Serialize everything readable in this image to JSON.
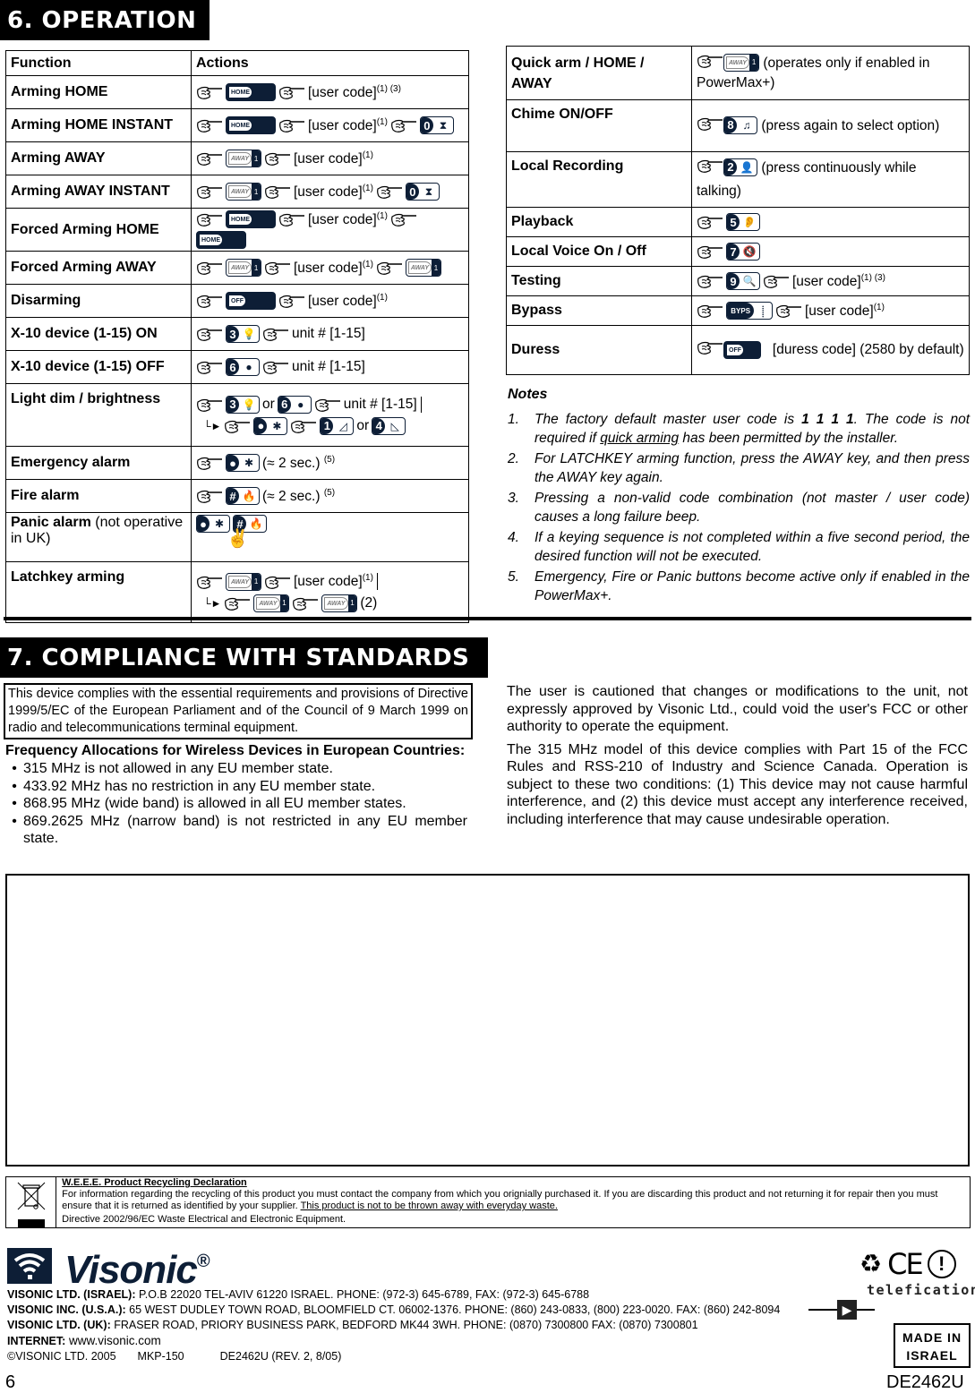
{
  "section6": {
    "title": "6. OPERATION",
    "table_left": {
      "headers": [
        "Function",
        "Actions"
      ],
      "rows": [
        {
          "function": "Arming HOME",
          "code": "[user code]",
          "sup": "(1) (3)"
        },
        {
          "function": "Arming HOME INSTANT",
          "code": "[user code]",
          "sup": "(1)"
        },
        {
          "function": "Arming AWAY",
          "code": "[user code]",
          "sup": "(1)"
        },
        {
          "function": "Arming AWAY INSTANT",
          "code": "[user code]",
          "sup": "(1)"
        },
        {
          "function": "Forced Arming HOME",
          "code": "[user code]",
          "sup": "(1)"
        },
        {
          "function": "Forced Arming AWAY",
          "code": "[user code]",
          "sup": "(1)"
        },
        {
          "function": "Disarming",
          "code": "[user code]",
          "sup": "(1)"
        },
        {
          "function": "X-10 device (1-15) ON",
          "code": "unit # [1-15]"
        },
        {
          "function": "X-10 device (1-15) OFF",
          "code": "unit # [1-15]"
        },
        {
          "function": "Light dim / brightness",
          "code": "unit # [1-15]",
          "or": "or"
        },
        {
          "function": "Emergency alarm",
          "code": "(≈ 2 sec.)",
          "sup": "(5)"
        },
        {
          "function": "Fire alarm",
          "code": "(≈ 2 sec.)",
          "sup": "(5)"
        },
        {
          "function": "Panic alarm",
          "function_note": "(not operative in UK)"
        },
        {
          "function": "Latchkey arming",
          "code": "[user code]",
          "sup": "(1)",
          "sup2": "(2)"
        }
      ]
    },
    "keys": {
      "home": "HOME",
      "away": "AWAY",
      "off": "OFF",
      "bypass": "BYPS",
      "lock_digit": "1"
    },
    "table_right": {
      "rows": [
        {
          "function": "Quick arm / HOME / AWAY",
          "text": "(operates only if enabled in PowerMax+)"
        },
        {
          "function": "Chime ON/OFF",
          "key": "8",
          "text": "(press again to select option)"
        },
        {
          "function": "Local Recording",
          "key": "2",
          "text": "(press continuously while talking)"
        },
        {
          "function": "Playback",
          "key": "5"
        },
        {
          "function": "Local Voice On / Off",
          "key": "7"
        },
        {
          "function": "Testing",
          "key": "9",
          "code": "[user code]",
          "sup": "(1)  (3)"
        },
        {
          "function": "Bypass",
          "code": "[user code]",
          "sup": "(1)"
        },
        {
          "function": "Duress",
          "code": "[duress code]",
          "text": "(2580 by default)"
        }
      ]
    },
    "notes": {
      "title": "Notes",
      "items": [
        {
          "num": "1.",
          "pre": "The factory default master user code is ",
          "bold": "1 1 1 1",
          "mid": ". The code is not required if ",
          "underline": "quick arming",
          "post": " has been permitted by the installer."
        },
        {
          "num": "2.",
          "text": "For LATCHKEY arming function, press the AWAY key, and then press the AWAY key again."
        },
        {
          "num": "3.",
          "text": "Pressing a non-valid code combination (not master / user code) causes a long failure beep."
        },
        {
          "num": "4.",
          "text": "If a keying sequence is not completed within a five second period, the desired function will not be executed."
        },
        {
          "num": "5.",
          "text": "Emergency, Fire or Panic buttons become active only if enabled in the PowerMax+."
        }
      ]
    }
  },
  "section7": {
    "title": "7. COMPLIANCE WITH STANDARDS",
    "directive_box": "This device complies with the essential requirements and provisions of Directive 1999/5/EC of the European Parliament and of the Council of 9 March 1999 on radio and telecommunications terminal equipment.",
    "freq_title": "Frequency Allocations for Wireless Devices in European Countries:",
    "freq_items": [
      "315 MHz is not allowed in any EU member state.",
      "433.92 MHz has no restriction in any EU member state.",
      "868.95 MHz (wide band) is allowed in all EU member states.",
      "869.2625 MHz (narrow band) is not restricted in any EU member state."
    ],
    "fcc_paragraphs": [
      "The user is cautioned that changes or modifications to the unit, not expressly approved by Visonic Ltd., could void the user's FCC or other authority to operate the equipment.",
      "The 315 MHz model of this device complies with Part 15 of the FCC Rules and RSS-210 of Industry and Science Canada. Operation is subject to these two conditions: (1) This device may not cause harmful interference, and (2) this device must accept any interference received, including interference that may cause undesirable operation."
    ]
  },
  "weee": {
    "title": "W.E.E.E. Product Recycling Declaration",
    "line1": "For  information regarding the recycling  of this product  you must contact the  company from which you orignially purchased it. If you are discarding this product and not returning it for repair then you must ensure that it is returned as identified by your supplier. ",
    "line1_underlined": "This product is not to be thrown away with everyday waste.",
    "line2": "Directive 2002/96/EC Waste Electrical and Electronic Equipment."
  },
  "footer": {
    "brand": "Visonic",
    "registered": "®",
    "addresses": [
      {
        "label": "VISONIC LTD. (ISRAEL):",
        "text": " P.O.B 22020 TEL-AVIV 61220 ISRAEL. PHONE: (972-3) 645-6789, FAX: (972-3) 645-6788"
      },
      {
        "label": "VISONIC INC. (U.S.A.):",
        "text": " 65 WEST DUDLEY TOWN ROAD, BLOOMFIELD CT. 06002-1376. PHONE: (860) 243-0833, (800) 223-0020. FAX: (860) 242-8094"
      },
      {
        "label": "VISONIC LTD. (UK):",
        "text": " FRASER ROAD, PRIORY BUSINESS PARK, BEDFORD MK44 3WH. PHONE: (0870) 7300800 FAX: (0870) 7300801"
      },
      {
        "label": "INTERNET:",
        "text": " www.visonic.com"
      }
    ],
    "copyright": "©VISONIC LTD. 2005",
    "model": "MKP-150",
    "doc_rev": "DE2462U (REV.  2,  8/05)",
    "cert_text": "telefication",
    "ce_mark": "CE",
    "made_in_line1": "MADE IN",
    "made_in_line2": "ISRAEL",
    "page_number": "6",
    "doc_id": "DE2462U"
  }
}
